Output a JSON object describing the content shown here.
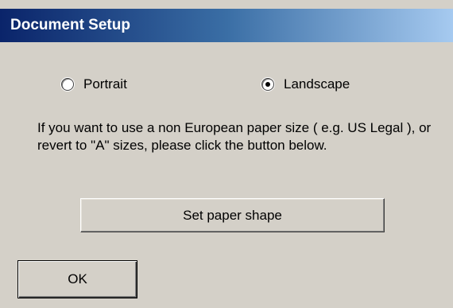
{
  "window": {
    "title": "Document Setup"
  },
  "orientation": {
    "options": [
      {
        "label": "Portrait",
        "selected": false
      },
      {
        "label": "Landscape",
        "selected": true
      }
    ]
  },
  "info": {
    "text": "If you want to use a non European paper size ( e.g. US Legal ), or revert to \"A\" sizes, please click the button below."
  },
  "buttons": {
    "set_paper_shape": "Set paper shape",
    "ok": "OK"
  },
  "colors": {
    "titlebar_start": "#0a246a",
    "titlebar_end": "#a6caf0",
    "dialog_background": "#d4d0c8"
  }
}
